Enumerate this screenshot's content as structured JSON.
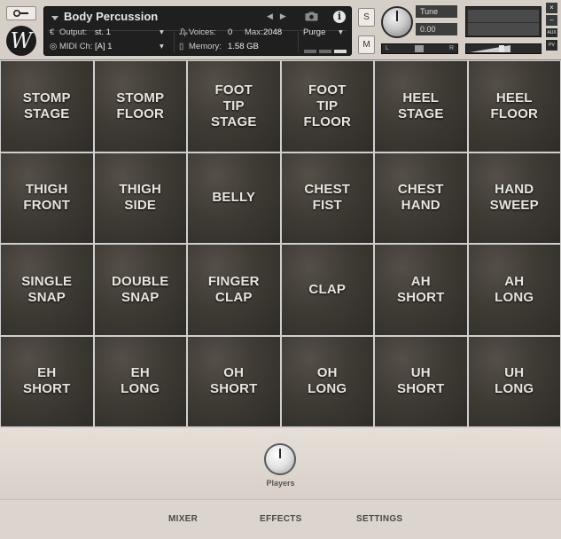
{
  "header": {
    "logo_letter": "W",
    "instrument_name": "Body Percussion",
    "output_label": "Output:",
    "output_value": "st. 1",
    "voices_label": "Voices:",
    "voices_value": "0",
    "max_label": "Max:",
    "max_value": "2048",
    "midi_label": "MIDI Ch:",
    "midi_value": "[A]  1",
    "memory_label": "Memory:",
    "memory_value": "1.58 GB",
    "purge_label": "Purge",
    "solo_label": "S",
    "mute_label": "M",
    "tune_label": "Tune",
    "tune_value": "0.00",
    "pan_left": "L",
    "pan_right": "R",
    "aux_label": "AUX",
    "pv_label": "PV",
    "close_label": "×",
    "minimize_label": "−"
  },
  "pads": [
    "STOMP\nSTAGE",
    "STOMP\nFLOOR",
    "FOOT\nTIP\nSTAGE",
    "FOOT\nTIP\nFLOOR",
    "HEEL\nSTAGE",
    "HEEL\nFLOOR",
    "THIGH\nFRONT",
    "THIGH\nSIDE",
    "BELLY",
    "CHEST\nFIST",
    "CHEST\nHAND",
    "HAND\nSWEEP",
    "SINGLE\nSNAP",
    "DOUBLE\nSNAP",
    "FINGER\nCLAP",
    "CLAP",
    "AH\nSHORT",
    "AH\nLONG",
    "EH\nSHORT",
    "EH\nLONG",
    "OH\nSHORT",
    "OH\nLONG",
    "UH\nSHORT",
    "UH\nLONG"
  ],
  "players": {
    "label": "Players"
  },
  "nav": {
    "mixer": "MIXER",
    "effects": "EFFECTS",
    "settings": "SETTINGS"
  }
}
